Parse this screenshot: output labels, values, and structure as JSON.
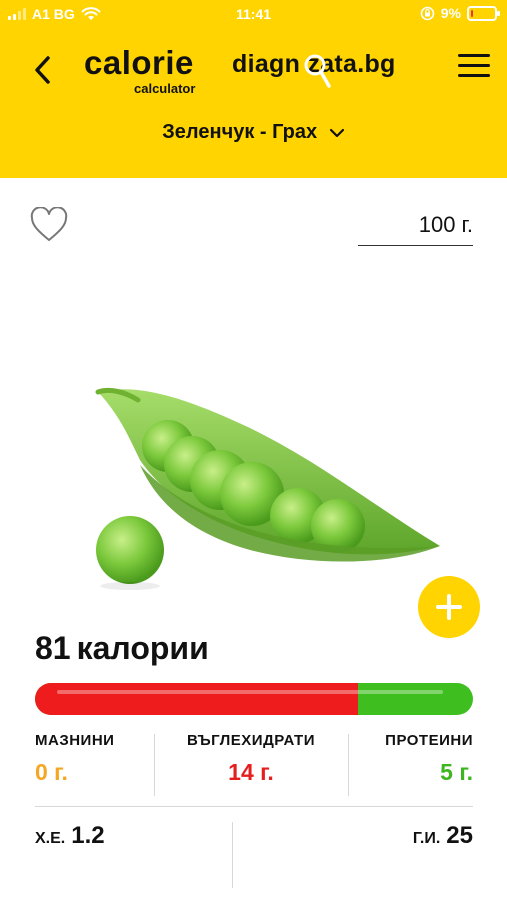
{
  "status_bar": {
    "carrier": "A1 BG",
    "time": "11:41",
    "battery": "9%",
    "battery_level": 0.09
  },
  "header": {
    "logo_calorie": "calorie",
    "logo_calculator": "calculator",
    "logo_diagnozata": "diagn zata.bg",
    "category": "Зеленчук - Грах"
  },
  "portion": {
    "quantity": "100 г."
  },
  "food": {
    "image": "green-peas-pod",
    "calories_value": "81",
    "calories_label": "калории"
  },
  "macros": {
    "fat": {
      "label": "МАЗНИНИ",
      "value": "0 г.",
      "color": "#F5A623"
    },
    "carbs": {
      "label": "ВЪГЛЕХИДРАТИ",
      "value": "14 г.",
      "color": "#E51E1E"
    },
    "protein": {
      "label": "ПРОТЕИНИ",
      "value": "5 г.",
      "color": "#3DB51F"
    },
    "bar_split": {
      "carbs": 14,
      "protein": 5,
      "fat": 0
    }
  },
  "footer": {
    "xe_label": "Х.Е.",
    "xe_value": "1.2",
    "gi_label": "Г.И.",
    "gi_value": "25"
  },
  "colors": {
    "accent": "#FFD400",
    "carbs": "#EE1C1C",
    "protein": "#3FBF1F",
    "fat": "#F5A623"
  }
}
